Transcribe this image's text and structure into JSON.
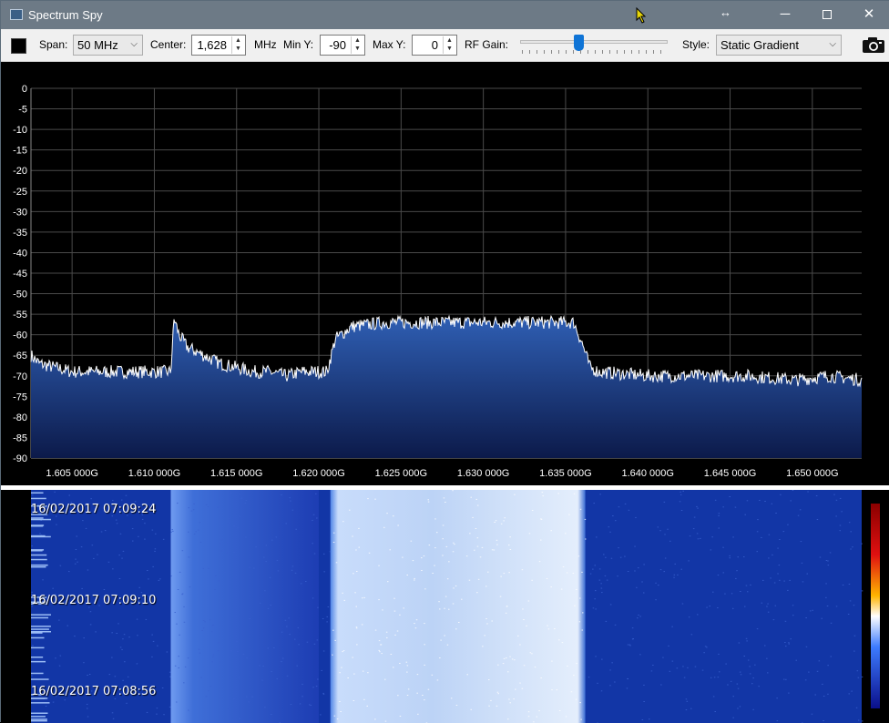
{
  "window": {
    "title": "Spectrum Spy",
    "minimize_glyph": "─",
    "close_glyph": "✕",
    "resize_glyph": "↔"
  },
  "toolbar": {
    "span_label": "Span:",
    "span_value": "50 MHz",
    "center_label": "Center:",
    "center_value": "1,628",
    "center_unit": "MHz",
    "miny_label": "Min Y:",
    "miny_value": "-90",
    "maxy_label": "Max Y:",
    "maxy_value": "0",
    "rfgain_label": "RF Gain:",
    "rfgain_level": 0.39,
    "style_label": "Style:",
    "style_value": "Static Gradient"
  },
  "icons": {
    "app": "spectrum-app-icon",
    "camera": "camera-icon",
    "color_swatch": "color-swatch"
  },
  "colors": {
    "fill_top": "#2f5fb4",
    "fill_bottom": "#0c1a4a",
    "trace": "#ffffff",
    "grid": "#4a4a4a"
  },
  "chart_data": {
    "type": "area",
    "title": "",
    "xlabel": "",
    "ylabel": "",
    "xlim": [
      1.6025,
      1.653
    ],
    "ylim": [
      -90,
      0
    ],
    "yticks": [
      0,
      -5,
      -10,
      -15,
      -20,
      -25,
      -30,
      -35,
      -40,
      -45,
      -50,
      -55,
      -60,
      -65,
      -70,
      -75,
      -80,
      -85,
      -90
    ],
    "xtick_values": [
      1.605,
      1.61,
      1.615,
      1.62,
      1.625,
      1.63,
      1.635,
      1.64,
      1.645,
      1.65
    ],
    "xtick_labels": [
      "1.605 000G",
      "1.610 000G",
      "1.615 000G",
      "1.620 000G",
      "1.625 000G",
      "1.630 000G",
      "1.635 000G",
      "1.640 000G",
      "1.645 000G",
      "1.650 000G"
    ],
    "grid": true,
    "series": [
      {
        "x": [
          1.6025,
          1.603,
          1.604,
          1.605,
          1.606,
          1.607,
          1.608,
          1.609,
          1.61,
          1.6105,
          1.611,
          1.6112,
          1.6115,
          1.612,
          1.613,
          1.614,
          1.615,
          1.616,
          1.617,
          1.618,
          1.619,
          1.62,
          1.6205,
          1.621,
          1.622,
          1.624,
          1.626,
          1.628,
          1.63,
          1.632,
          1.634,
          1.6355,
          1.636,
          1.6365,
          1.637,
          1.64,
          1.643,
          1.646,
          1.649,
          1.651,
          1.653
        ],
        "y": [
          -65,
          -67,
          -68,
          -69,
          -69,
          -69,
          -69,
          -69,
          -69,
          -69,
          -69,
          -56,
          -60,
          -63,
          -65,
          -67,
          -68,
          -69,
          -69,
          -70,
          -69,
          -69,
          -69,
          -61,
          -58,
          -57,
          -57,
          -57,
          -57,
          -57,
          -57,
          -57,
          -62,
          -68,
          -69,
          -70,
          -70,
          -70,
          -71,
          -70,
          -71
        ]
      }
    ]
  },
  "waterfall": {
    "timestamps": [
      "16/02/2017 07:09:24",
      "16/02/2017 07:09:10",
      "16/02/2017 07:08:56"
    ],
    "signal_band_start": 1.6207,
    "signal_band_end": 1.6362,
    "burst_start": 1.611
  }
}
